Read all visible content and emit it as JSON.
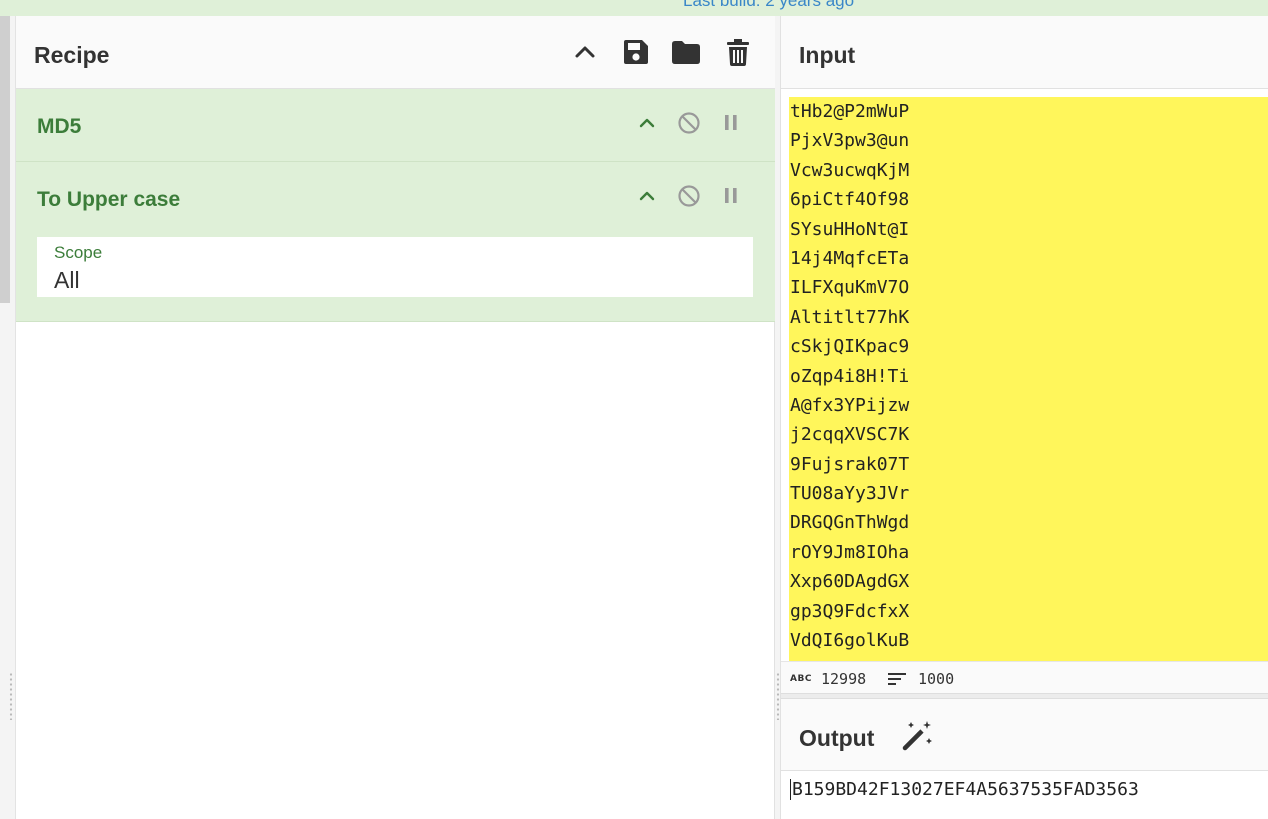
{
  "banner": {
    "text": "Last build: 2 years ago"
  },
  "recipe": {
    "title": "Recipe",
    "icons": [
      "chevron-up-icon",
      "save-icon",
      "folder-icon",
      "trash-icon"
    ],
    "operations": [
      {
        "name": "MD5"
      },
      {
        "name": "To Upper case",
        "scope_label": "Scope",
        "scope_value": "All"
      }
    ]
  },
  "input": {
    "title": "Input",
    "lines": [
      "tHb2@P2mWuP",
      "PjxV3pw3@un",
      "Vcw3ucwqKjM",
      "6piCtf4Of98",
      "SYsuHHoNt@I",
      "14j4MqfcETa",
      "ILFXquKmV7O",
      "Altitlt77hK",
      "cSkjQIKpac9",
      "oZqp4i8H!Ti",
      "A@fx3YPijzw",
      "j2cqqXVSC7K",
      "9Fujsrak07T",
      "TU08aYy3JVr",
      "DRGQGnThWgd",
      "rOY9Jm8IOha",
      "Xxp60DAgdGX",
      "gp3Q9FdcfxX",
      "VdQI6golKuB"
    ],
    "status": {
      "abc_label": "ABC",
      "char_count": "12998",
      "line_count": "1000"
    }
  },
  "output": {
    "title": "Output",
    "value": "B159BD42F13027EF4A5637535FAD3563"
  },
  "colors": {
    "op_background": "#dff0d8",
    "op_text": "#3c7d3a",
    "input_highlight": "#fff65b",
    "link_blue": "#3a87c8"
  }
}
